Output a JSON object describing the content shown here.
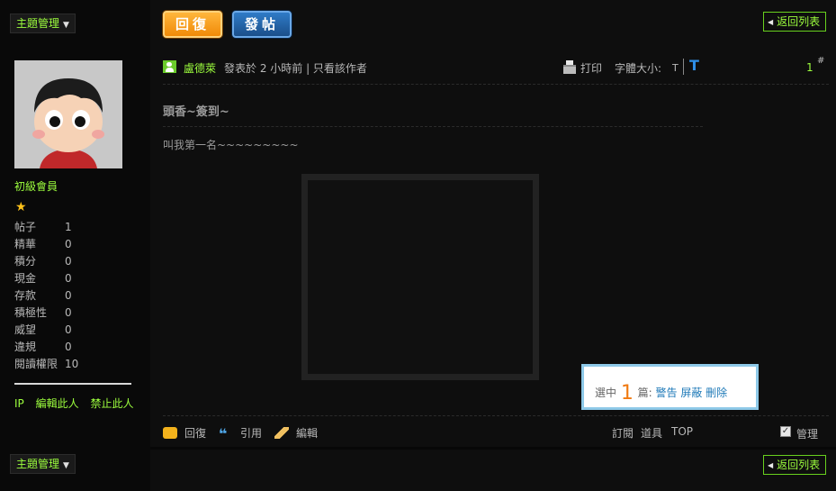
{
  "toolbar": {
    "topic_manage": "主題管理",
    "reply": "回復",
    "new_post": "發帖",
    "back_to_list": "返回列表"
  },
  "user": {
    "rank": "初級會員",
    "stats": [
      {
        "label": "帖子",
        "value": "1"
      },
      {
        "label": "精華",
        "value": "0"
      },
      {
        "label": "積分",
        "value": "0"
      },
      {
        "label": "現金",
        "value": "0"
      },
      {
        "label": "存款",
        "value": "0"
      },
      {
        "label": "積極性",
        "value": "0"
      },
      {
        "label": "威望",
        "value": "0"
      },
      {
        "label": "違規",
        "value": "0"
      },
      {
        "label": "閱讀權限",
        "value": "10"
      }
    ],
    "actions": {
      "ip": "IP",
      "edit": "編輯此人",
      "ban": "禁止此人"
    }
  },
  "post": {
    "author": "盧德萊",
    "posted": "發表於 2 小時前 | 只看該作者",
    "print": "打印",
    "font_size_label": "字體大小:",
    "font_small": "T",
    "font_large": "T",
    "floor": "1",
    "floor_mark": "#",
    "title": "頭香~簽到~",
    "body": "叫我第一名~~~~~~~~~"
  },
  "selection": {
    "prefix": "選中",
    "count": "1",
    "suffix": "篇:",
    "tools": "警告 屏蔽 刪除"
  },
  "footer": {
    "reply": "回復",
    "quote": "引用",
    "edit": "編輯",
    "subscribe": "訂閱",
    "props": "道具",
    "top": "TOP",
    "manage": "管理"
  },
  "colors": {
    "accent_green": "#9dff3e",
    "reply_orange": "#f08a08",
    "post_blue": "#1b4f8a",
    "link_blue": "#1f7ab8"
  }
}
